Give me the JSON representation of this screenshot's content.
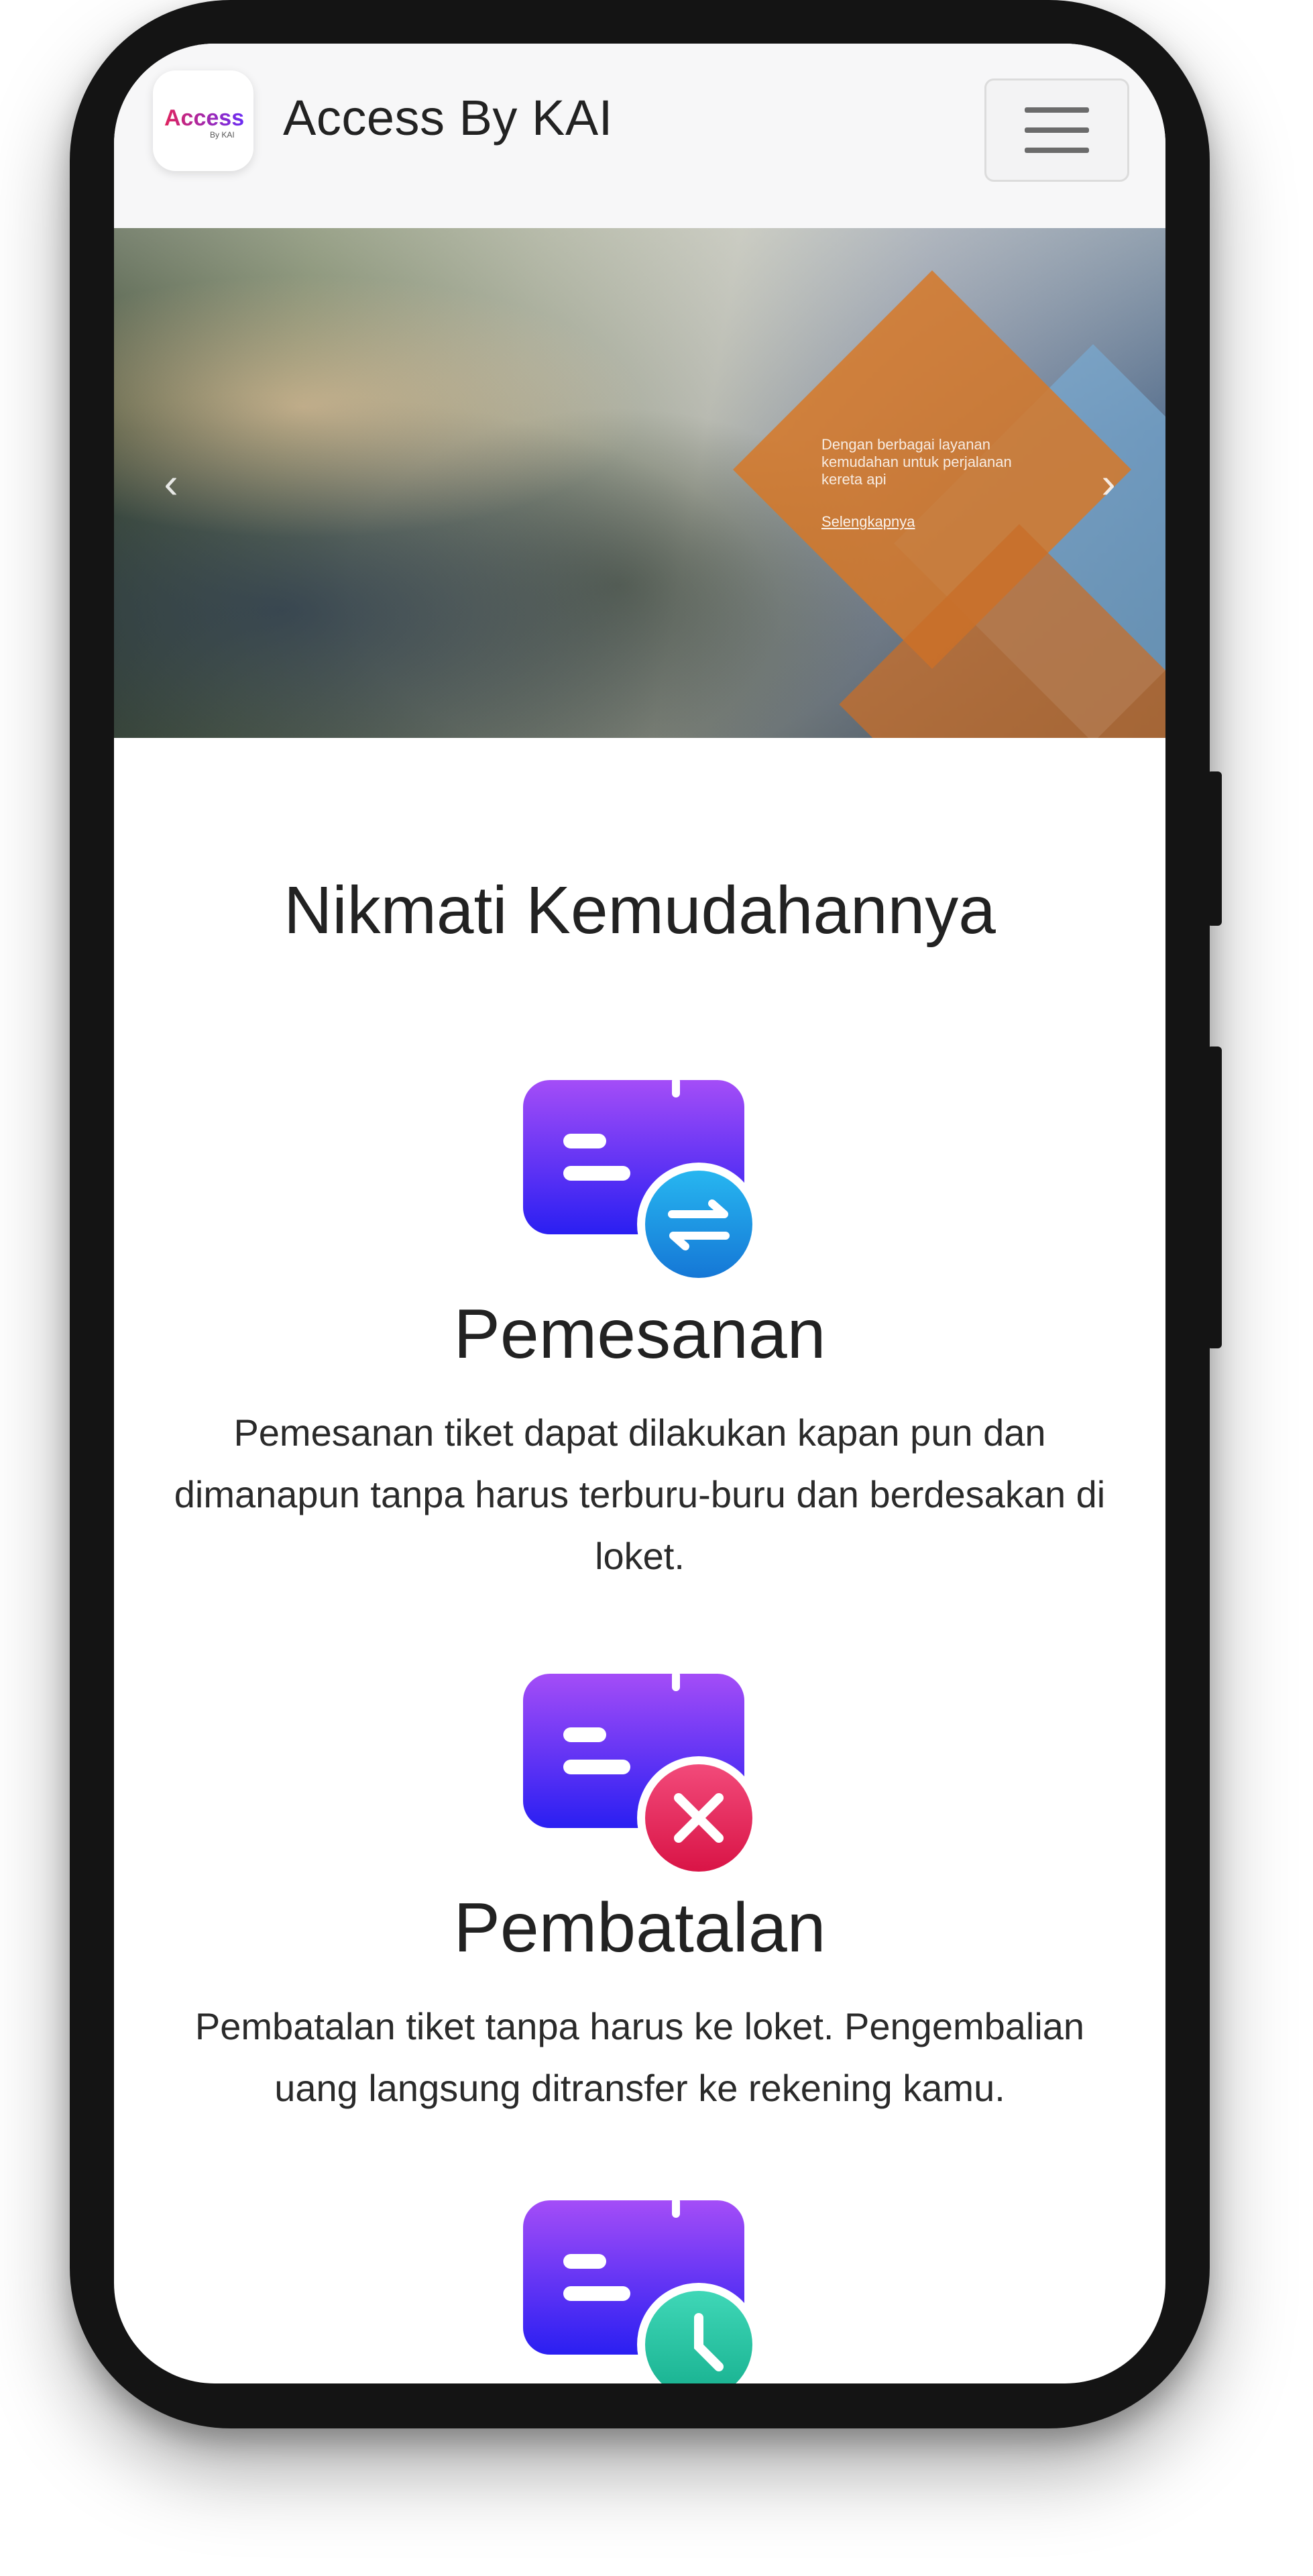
{
  "navbar": {
    "brand_title": "Access By KAI",
    "logo_text": "Access",
    "logo_sub": "By KAI"
  },
  "hero": {
    "slide_text": "Dengan berbagai layanan kemudahan untuk perjalanan kereta api",
    "slide_link": "Selengkapnya",
    "prev_label": "‹",
    "next_label": "›"
  },
  "main": {
    "section_title": "Nikmati Kemudahannya",
    "features": [
      {
        "title": "Pemesanan",
        "description": "Pemesanan tiket dapat dilakukan kapan pun dan dimanapun tanpa harus terburu-buru dan berdesakan di loket.",
        "icon": "booking-exchange-icon",
        "badge_color": "#1e9be8"
      },
      {
        "title": "Pembatalan",
        "description": "Pembatalan tiket tanpa harus ke loket. Pengembalian uang langsung ditransfer ke rekening kamu.",
        "icon": "booking-cancel-icon",
        "badge_color": "#e8275a"
      },
      {
        "title": "",
        "description": "",
        "icon": "booking-schedule-icon",
        "badge_color": "#22c3a6"
      }
    ]
  },
  "colors": {
    "accent_purple": "#8b3cf5",
    "accent_blue": "#2f23f0",
    "frame": "#141414"
  }
}
